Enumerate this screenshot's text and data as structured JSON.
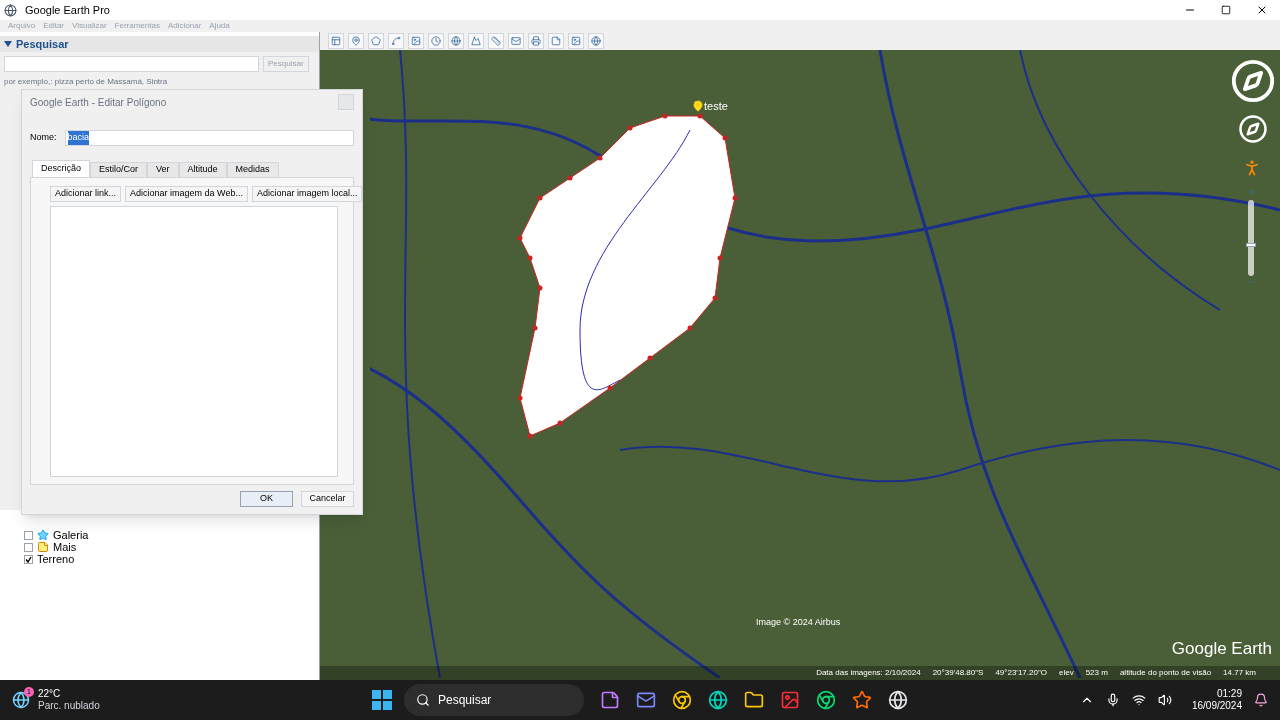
{
  "window": {
    "title": "Google Earth Pro"
  },
  "menu": [
    {
      "label": "Arquivo",
      "disabled": true
    },
    {
      "label": "Editar",
      "disabled": true
    },
    {
      "label": "Visualizar",
      "disabled": true
    },
    {
      "label": "Ferramentas",
      "disabled": true
    },
    {
      "label": "Adicionar",
      "disabled": true
    },
    {
      "label": "Ajuda",
      "disabled": true
    }
  ],
  "search_panel": {
    "header": "Pesquisar",
    "expanded": true,
    "button": "Pesquisar",
    "hint": "por exemplo,: pizza perto de Massamá, Sintra"
  },
  "layers": [
    {
      "label": "Galeria",
      "checked": false
    },
    {
      "label": "Mais",
      "checked": false
    },
    {
      "label": "Terreno",
      "checked": true
    }
  ],
  "map": {
    "zoom": {
      "level": 0.4
    },
    "placemark": "teste",
    "attribution": "Image © 2024 Airbus",
    "logo": "Google Earth",
    "status": [
      "Data das imagens: 2/10/2024",
      "20°39'48.80\"S",
      "49°23'17.20\"O",
      "elev",
      "523 m",
      "altitude do ponto de visão",
      "14.77 km"
    ]
  },
  "dialog": {
    "title": "Google Earth - Editar Polígono",
    "name_label": "Nome:",
    "name_value": "bacia",
    "tabs": [
      {
        "label": "Descrição",
        "selected": true
      },
      {
        "label": "Estilo/Cor",
        "selected": false
      },
      {
        "label": "Ver",
        "selected": false
      },
      {
        "label": "Altitude",
        "selected": false
      },
      {
        "label": "Medidas",
        "selected": false
      }
    ],
    "actions": [
      "Adicionar link...",
      "Adicionar imagem da Web...",
      "Adicionar imagem local..."
    ],
    "ok": "OK",
    "cancel": "Cancelar"
  },
  "taskbar": {
    "weather": {
      "temperature": "22°C",
      "condition": "Parc. nublado",
      "badge": "1"
    },
    "search": "Pesquisar",
    "time": "01:29",
    "date": "16/09/2024"
  }
}
